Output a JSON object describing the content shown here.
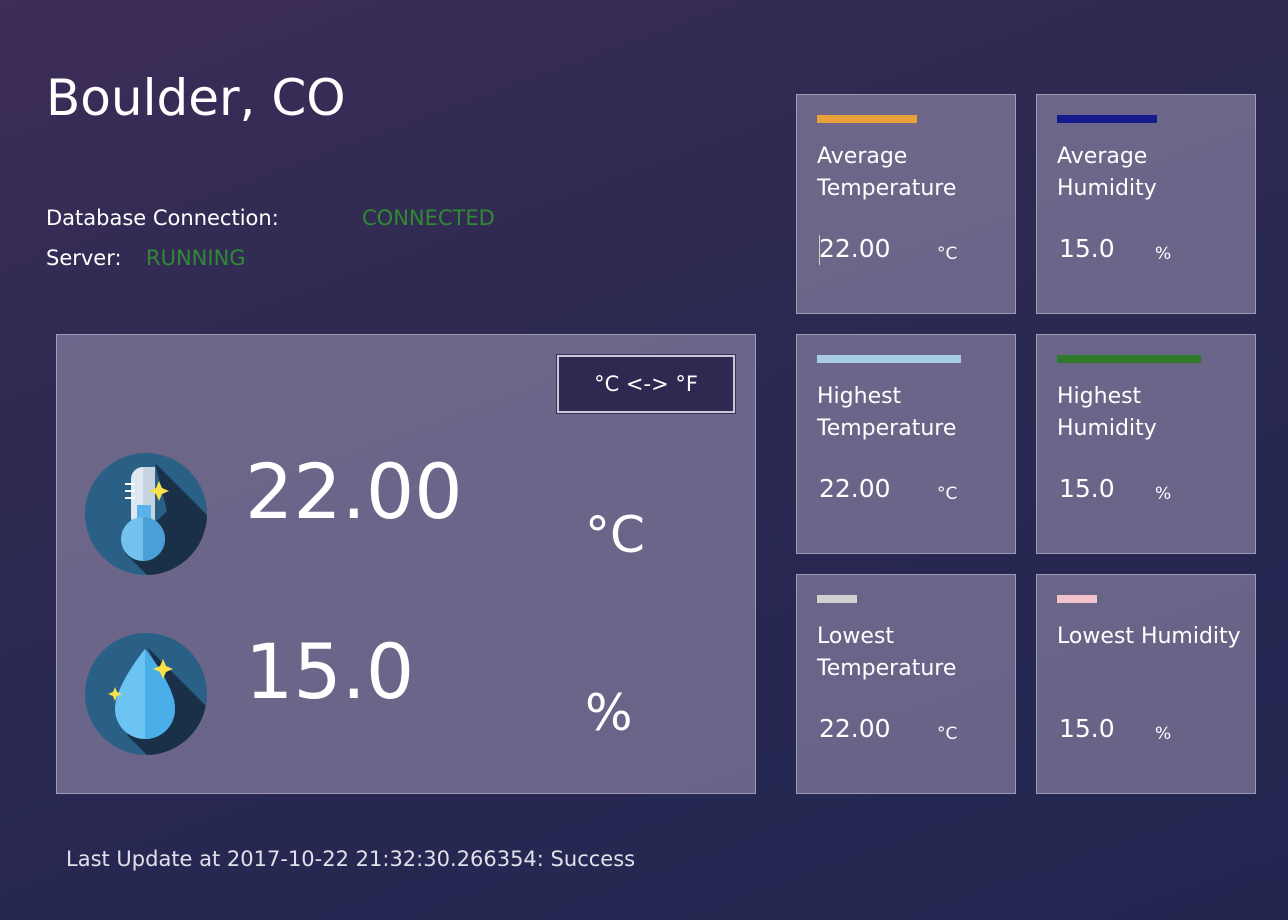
{
  "location": {
    "city": "Boulder, CO"
  },
  "status": {
    "database_label": "Database Connection:",
    "database_value": "CONNECTED",
    "server_label": "Server:",
    "server_value": "RUNNING",
    "ok_color": "#2f8a33"
  },
  "main": {
    "toggle_label": "°C <-> °F",
    "temperature": {
      "value": "22.00",
      "unit": "°C",
      "icon": "thermometer-icon"
    },
    "humidity": {
      "value": "15.0",
      "unit": "%",
      "icon": "water-drop-icon"
    }
  },
  "stats": [
    {
      "id": "avg-temp",
      "label": "Average Temperature",
      "value": "22.00",
      "unit": "°C",
      "accent": "#e9a23a"
    },
    {
      "id": "avg-hum",
      "label": "Average Humidity",
      "value": "15.0",
      "unit": "%",
      "accent": "#141a8a"
    },
    {
      "id": "high-temp",
      "label": "Highest Temperature",
      "value": "22.00",
      "unit": "°C",
      "accent": "#a8cce2"
    },
    {
      "id": "high-hum",
      "label": "Highest Humidity",
      "value": "15.0",
      "unit": "%",
      "accent": "#2f7a2a"
    },
    {
      "id": "low-temp",
      "label": "Lowest Temperature",
      "value": "22.00",
      "unit": "°C",
      "accent": "#cfd0cf"
    },
    {
      "id": "low-hum",
      "label": "Lowest Humidity",
      "value": "15.0",
      "unit": "%",
      "accent": "#f2c1cb"
    }
  ],
  "footer": {
    "last_update": "Last Update at 2017-10-22 21:32:30.266354: Success"
  }
}
